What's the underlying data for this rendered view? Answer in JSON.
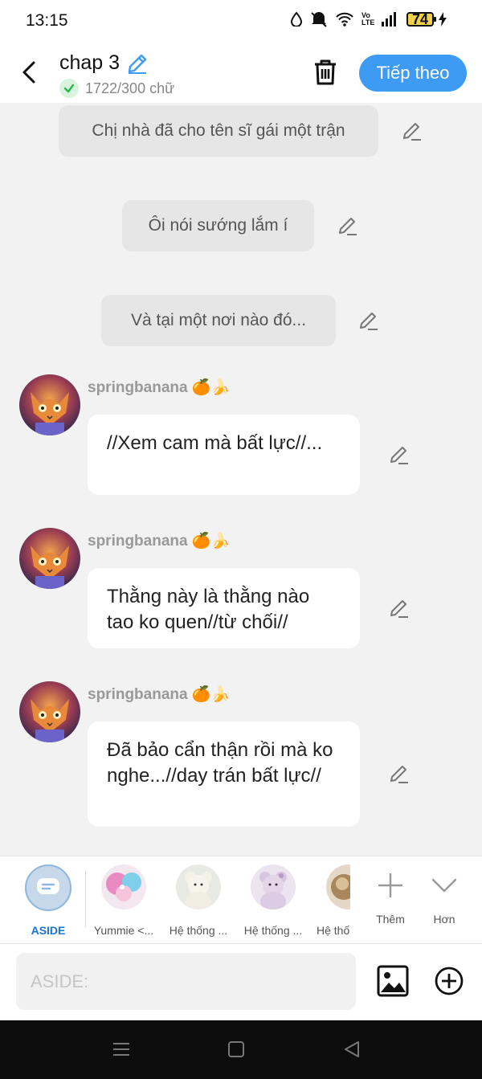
{
  "status": {
    "time": "13:15",
    "network": "Vo LTE",
    "battery": "74"
  },
  "header": {
    "title": "chap 3",
    "word_count": "1722/300 chữ",
    "next_label": "Tiếp theo"
  },
  "narration": [
    {
      "text": "Chị nhà đã cho tên sĩ gái một trận"
    },
    {
      "text": "Ôi nói sướng lắm í"
    },
    {
      "text": "Và tại một nơi nào đó..."
    }
  ],
  "messages": [
    {
      "user": "springbanana 🍊🍌",
      "text": "//Xem cam mà bất lực//..."
    },
    {
      "user": "springbanana 🍊🍌",
      "text": "Thằng này là thằng nào tao ko quen//từ chối//"
    },
    {
      "user": "springbanana 🍊🍌",
      "text": "Đã bảo cẩn thận rồi mà ko nghe...//day trán bất lực//"
    }
  ],
  "characters": {
    "aside_label": "ASIDE",
    "items": [
      {
        "label": "Yummie <..."
      },
      {
        "label": "Hệ thống ..."
      },
      {
        "label": "Hệ thống ..."
      },
      {
        "label": "Hệ thố"
      }
    ],
    "more_label": "Thêm",
    "expand_label": "Hơn"
  },
  "input": {
    "placeholder": "ASIDE:"
  },
  "colors": {
    "accent": "#3d9bf3",
    "aside_selected": "#1e73d6"
  }
}
